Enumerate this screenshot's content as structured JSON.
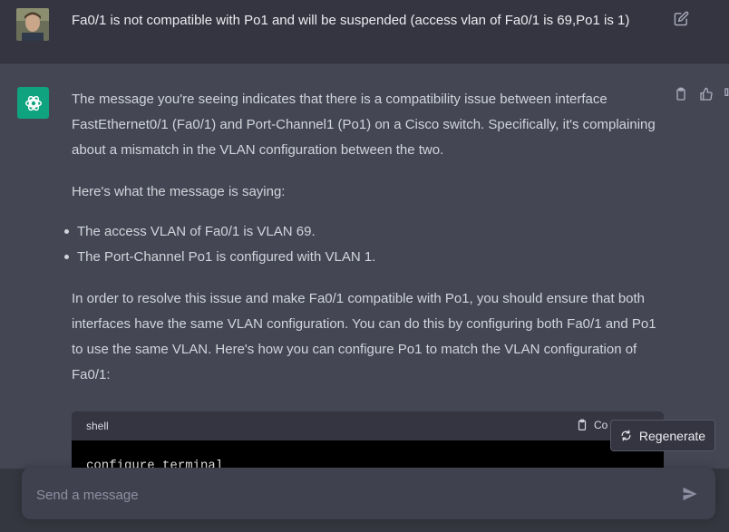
{
  "user_message": {
    "text": "Fa0/1 is not compatible with Po1 and will be suspended (access vlan of Fa0/1 is 69,Po1 is 1)"
  },
  "assistant_message": {
    "paragraph_1": "The message you're seeing indicates that there is a compatibility issue between interface FastEthernet0/1 (Fa0/1) and Port-Channel1 (Po1) on a Cisco switch. Specifically, it's complaining about a mismatch in the VLAN configuration between the two.",
    "paragraph_2": "Here's what the message is saying:",
    "bullets": [
      "The access VLAN of Fa0/1 is VLAN 69.",
      "The Port-Channel Po1 is configured with VLAN 1."
    ],
    "paragraph_3": "In order to resolve this issue and make Fa0/1 compatible with Po1, you should ensure that both interfaces have the same VLAN configuration. You can do this by configuring both Fa0/1 and Po1 to use the same VLAN. Here's how you can configure Po1 to match the VLAN configuration of Fa0/1:"
  },
  "code_block": {
    "language": "shell",
    "copy_label": "Co",
    "first_line": "configure terminal"
  },
  "regenerate_label": "Regenerate",
  "composer": {
    "placeholder": "Send a message"
  },
  "colors": {
    "accent": "#10a37f",
    "assistant_bg": "#444654",
    "user_bg": "#343541"
  }
}
